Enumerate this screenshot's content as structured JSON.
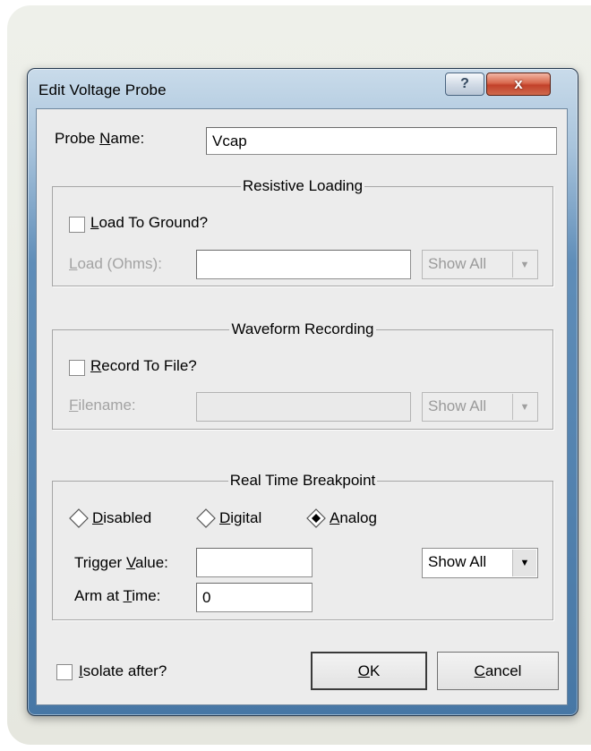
{
  "dialog": {
    "title": "Edit Voltage Probe",
    "help_glyph": "?",
    "close_glyph": "x"
  },
  "probe_name": {
    "label_pre": "Probe ",
    "label_key": "N",
    "label_post": "ame:",
    "value": "Vcap"
  },
  "resistive_loading": {
    "title": "Resistive Loading",
    "checkbox_key": "L",
    "checkbox_rest": "oad To Ground?",
    "checked": false,
    "load_key": "L",
    "load_rest": "oad (Ohms):",
    "load_value": "",
    "units_value": "Show All"
  },
  "waveform_recording": {
    "title": "Waveform Recording",
    "checkbox_key": "R",
    "checkbox_rest": "ecord To File?",
    "checked": false,
    "filename_key": "F",
    "filename_rest": "ilename:",
    "filename_value": "",
    "units_value": "Show All"
  },
  "realtime_breakpoint": {
    "title": "Real Time Breakpoint",
    "modes": [
      {
        "key": "D",
        "rest": "isabled",
        "selected": false
      },
      {
        "key": "D",
        "rest": "igital",
        "selected": false
      },
      {
        "key": "A",
        "rest": "nalog",
        "selected": true
      }
    ],
    "trigger_pre": "Trigger ",
    "trigger_key": "V",
    "trigger_post": "alue:",
    "trigger_value": "",
    "arm_pre": "Arm at ",
    "arm_key": "T",
    "arm_post": "ime:",
    "arm_value": "0",
    "units_value": "Show All"
  },
  "isolate": {
    "key": "I",
    "rest": "solate after?",
    "checked": false
  },
  "buttons": {
    "ok_key": "O",
    "ok_rest": "K",
    "cancel_key": "C",
    "cancel_rest": "ancel"
  },
  "icons": {
    "dropdown": "chevron-down-icon",
    "help": "help-icon",
    "close": "close-icon"
  }
}
